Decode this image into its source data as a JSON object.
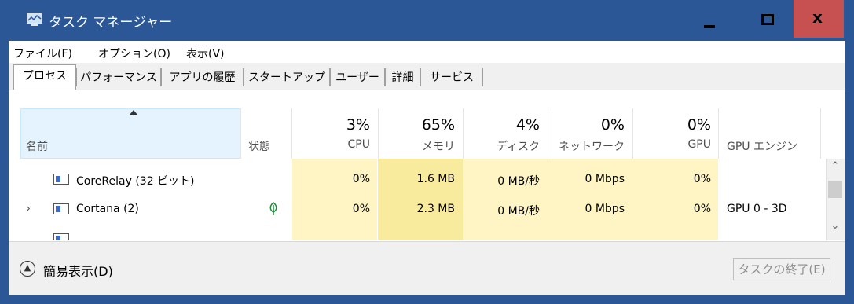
{
  "window": {
    "title": "タスク マネージャー",
    "close_glyph": "x"
  },
  "menu": {
    "items": [
      "ファイル(F)",
      "オプション(O)",
      "表示(V)"
    ]
  },
  "tabs": [
    "プロセス",
    "パフォーマンス",
    "アプリの履歴",
    "スタートアップ",
    "ユーザー",
    "詳細",
    "サービス"
  ],
  "active_tab": 0,
  "columns": {
    "name": "名前",
    "status": "状態",
    "cpu": {
      "pct": "3%",
      "label": "CPU"
    },
    "memory": {
      "pct": "65%",
      "label": "メモリ"
    },
    "disk": {
      "pct": "4%",
      "label": "ディスク"
    },
    "network": {
      "pct": "0%",
      "label": "ネットワーク"
    },
    "gpu": {
      "pct": "0%",
      "label": "GPU"
    },
    "gpu_engine": "GPU エンジン"
  },
  "rows": [
    {
      "name": "CoreRelay (32 ビット)",
      "cpu": "0%",
      "memory": "1.6 MB",
      "disk": "0 MB/秒",
      "network": "0 Mbps",
      "gpu": "0%",
      "gpu_engine": ""
    },
    {
      "name": "Cortana (2)",
      "cpu": "0%",
      "memory": "2.3 MB",
      "disk": "0 MB/秒",
      "network": "0 Mbps",
      "gpu": "0%",
      "gpu_engine": "GPU 0 - 3D"
    }
  ],
  "footer": {
    "fewer_details": "簡易表示(D)",
    "end_task": "タスクの終了(E)"
  },
  "colors": {
    "titlebar": "#2b5797",
    "close": "#c75050",
    "heat_light": "#fff4c4",
    "heat_mid": "#f9eb9e"
  }
}
